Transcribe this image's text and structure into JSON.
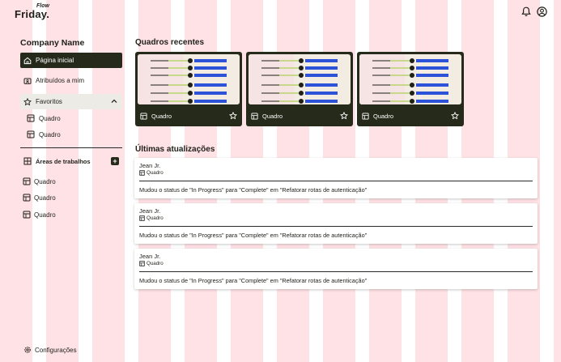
{
  "app": {
    "logo_flow": "Flow",
    "logo_friday": "Friday."
  },
  "header": {
    "bell_icon": "bell-icon",
    "profile_icon": "user-circle-icon"
  },
  "sidebar": {
    "company_name": "Company Name",
    "nav": [
      {
        "label": "Página inicial",
        "icon": "home-icon",
        "active": true
      },
      {
        "label": "Atribuídos a mim",
        "icon": "id-card-icon"
      },
      {
        "label": "Favoritos",
        "icon": "star-icon",
        "expanded": true
      }
    ],
    "favorites": [
      {
        "label": "Quadro"
      },
      {
        "label": "Quadro"
      }
    ],
    "workspaces_title": "Áreas de trabalhos",
    "workspaces_add": "+",
    "workspaces": [
      {
        "label": "Quadro"
      },
      {
        "label": "Quadro"
      },
      {
        "label": "Quadro"
      }
    ],
    "settings_label": "Configurações"
  },
  "main": {
    "recent_title": "Quadros recentes",
    "recent_boards": [
      {
        "label": "Quadro"
      },
      {
        "label": "Quadro"
      },
      {
        "label": "Quadro"
      }
    ],
    "updates_title": "Últimas atualizações",
    "updates": [
      {
        "user": "Jean Jr.",
        "board": "Quadro",
        "message": "Mudou o status de \"In Progress\" para \"Complete\" em \"Refatorar rotas de autenticação\""
      },
      {
        "user": "Jean Jr.",
        "board": "Quadro",
        "message": "Mudou o status de \"In Progress\" para \"Complete\" em \"Refatorar rotas de autenticação\""
      },
      {
        "user": "Jean Jr.",
        "board": "Quadro",
        "message": "Mudou o status de \"In Progress\" para \"Complete\" em \"Refatorar rotas de autenticação\""
      }
    ]
  },
  "colors": {
    "dark": "#252a1b",
    "accent_blue": "#2b52d9",
    "accent_green": "#c8d88a",
    "background_stripe": "#ffe2e5"
  }
}
